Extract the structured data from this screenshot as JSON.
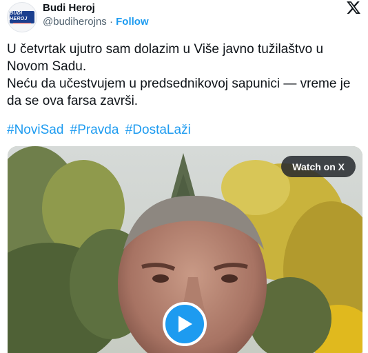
{
  "header": {
    "avatar_text": "BUDI HEROJ",
    "display_name": "Budi Heroj",
    "handle": "@budiherojns",
    "separator": "·",
    "follow_label": "Follow"
  },
  "tweet": {
    "lines": [
      "U četvrtak ujutro sam dolazim u Više javno tužilaštvo u Novom Sadu.",
      "Neću da učestvujem u predsednikovoj sapunici — vreme je da se ova farsa završi."
    ],
    "hashtags": [
      "#NoviSad",
      "#Pravda",
      "#DostaLaži"
    ]
  },
  "media": {
    "watch_label": "Watch on X"
  },
  "colors": {
    "accent": "#1d9bf0",
    "text": "#0f1419",
    "secondary": "#536471",
    "avatar_badge": "#1b3f8f"
  }
}
